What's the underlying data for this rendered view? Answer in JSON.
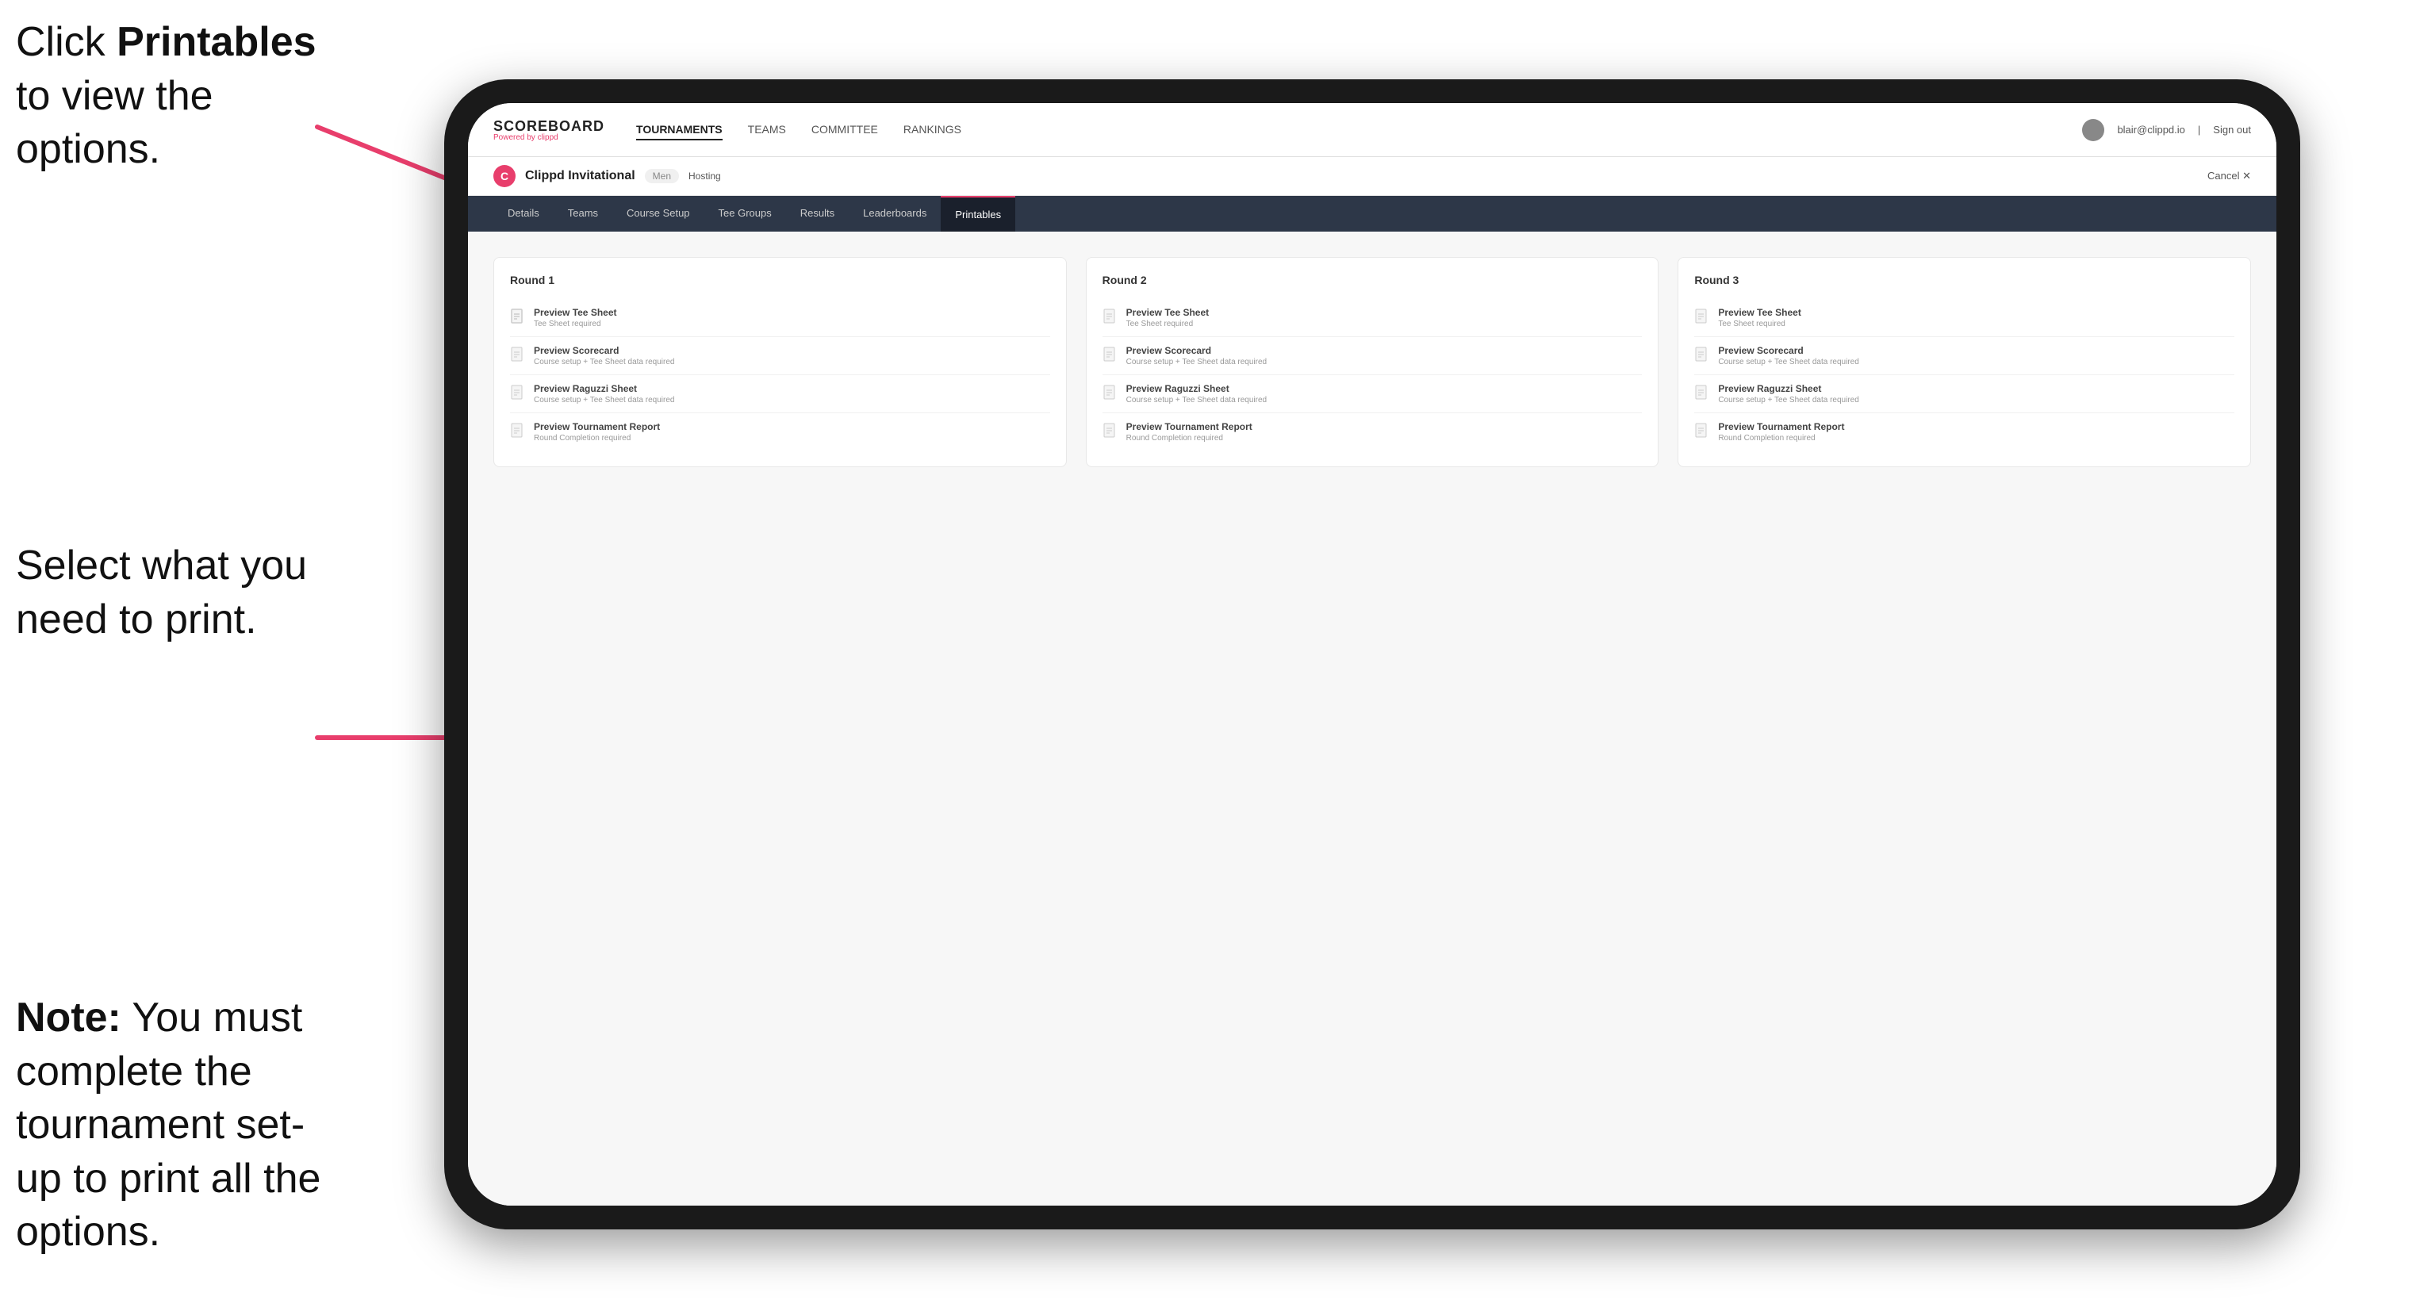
{
  "annotations": {
    "top": {
      "prefix": "Click ",
      "bold": "Printables",
      "suffix": " to view the options."
    },
    "mid": {
      "text": "Select what you need to print."
    },
    "bottom": {
      "bold_prefix": "Note:",
      "text": " You must complete the tournament set-up to print all the options."
    }
  },
  "nav": {
    "logo": "SCOREBOARD",
    "powered_by": "Powered by clippd",
    "links": [
      "TOURNAMENTS",
      "TEAMS",
      "COMMITTEE",
      "RANKINGS"
    ],
    "active_link": "TOURNAMENTS",
    "user_email": "blair@clippd.io",
    "sign_out": "Sign out"
  },
  "tournament": {
    "logo_letter": "C",
    "name": "Clippd Invitational",
    "gender": "Men",
    "status": "Hosting",
    "cancel": "Cancel ✕"
  },
  "tabs": [
    "Details",
    "Teams",
    "Course Setup",
    "Tee Groups",
    "Results",
    "Leaderboards",
    "Printables"
  ],
  "active_tab": "Printables",
  "rounds": [
    {
      "title": "Round 1",
      "items": [
        {
          "title": "Preview Tee Sheet",
          "subtitle": "Tee Sheet required"
        },
        {
          "title": "Preview Scorecard",
          "subtitle": "Course setup + Tee Sheet data required"
        },
        {
          "title": "Preview Raguzzi Sheet",
          "subtitle": "Course setup + Tee Sheet data required"
        },
        {
          "title": "Preview Tournament Report",
          "subtitle": "Round Completion required"
        }
      ]
    },
    {
      "title": "Round 2",
      "items": [
        {
          "title": "Preview Tee Sheet",
          "subtitle": "Tee Sheet required"
        },
        {
          "title": "Preview Scorecard",
          "subtitle": "Course setup + Tee Sheet data required"
        },
        {
          "title": "Preview Raguzzi Sheet",
          "subtitle": "Course setup + Tee Sheet data required"
        },
        {
          "title": "Preview Tournament Report",
          "subtitle": "Round Completion required"
        }
      ]
    },
    {
      "title": "Round 3",
      "items": [
        {
          "title": "Preview Tee Sheet",
          "subtitle": "Tee Sheet required"
        },
        {
          "title": "Preview Scorecard",
          "subtitle": "Course setup + Tee Sheet data required"
        },
        {
          "title": "Preview Raguzzi Sheet",
          "subtitle": "Course setup + Tee Sheet data required"
        },
        {
          "title": "Preview Tournament Report",
          "subtitle": "Round Completion required"
        }
      ]
    }
  ]
}
